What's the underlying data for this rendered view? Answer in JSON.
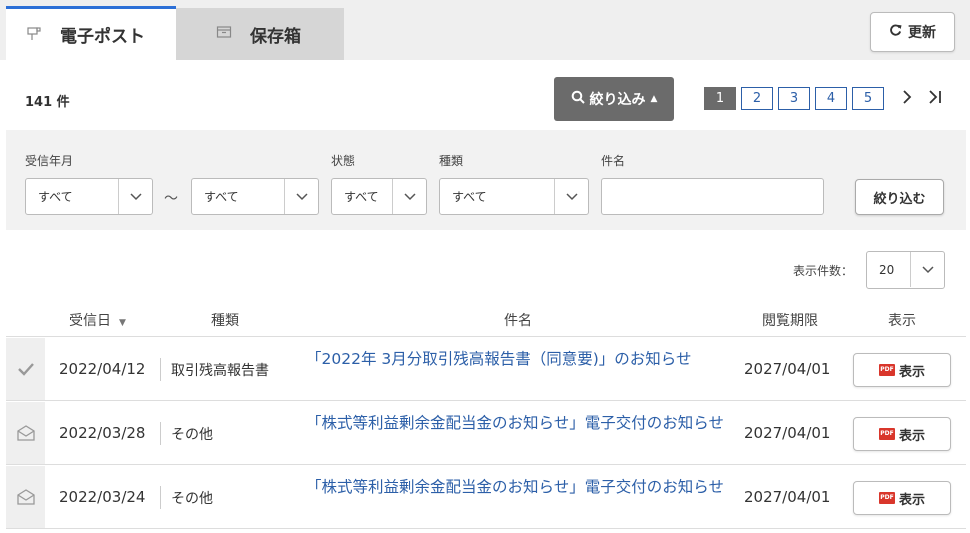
{
  "tabs": [
    {
      "label": "電子ポスト",
      "icon": "mailbox-icon"
    },
    {
      "label": "保存箱",
      "icon": "box-icon"
    }
  ],
  "refresh": {
    "label": "更新",
    "icon": "refresh-icon"
  },
  "count": "141 件",
  "filter_toggle": {
    "label": "絞り込み",
    "icon": "search-icon"
  },
  "pagination": {
    "pages": [
      "1",
      "2",
      "3",
      "4",
      "5"
    ],
    "current": "1"
  },
  "filters": {
    "received_label": "受信年月",
    "received_from": "すべて",
    "range_sep": "～",
    "received_to": "すべて",
    "status_label": "状態",
    "status_value": "すべて",
    "type_label": "種類",
    "type_value": "すべて",
    "subject_label": "件名",
    "subject_value": "",
    "apply_label": "絞り込む"
  },
  "per_page": {
    "label": "表示件数：",
    "value": "20"
  },
  "table": {
    "headers": {
      "date": "受信日",
      "type": "種類",
      "subject": "件名",
      "deadline": "閲覧期限",
      "view": "表示"
    },
    "rows": [
      {
        "status_icon": "check-icon",
        "date": "2022/04/12",
        "type": "取引残高報告書",
        "subject": "「2022年 3月分取引残高報告書（同意要)」のお知らせ",
        "deadline": "2027/04/01",
        "view_label": "表示"
      },
      {
        "status_icon": "envelope-icon",
        "date": "2022/03/28",
        "type": "その他",
        "subject": "「株式等利益剰余金配当金のお知らせ」電子交付のお知らせ",
        "deadline": "2027/04/01",
        "view_label": "表示"
      },
      {
        "status_icon": "envelope-icon",
        "date": "2022/03/24",
        "type": "その他",
        "subject": "「株式等利益剰余金配当金のお知らせ」電子交付のお知らせ",
        "deadline": "2027/04/01",
        "view_label": "表示"
      }
    ]
  },
  "colors": {
    "accent": "#2c6fd6",
    "link": "#2c5fa8",
    "dark_button": "#6b6b6b",
    "pdf": "#d9362b"
  }
}
